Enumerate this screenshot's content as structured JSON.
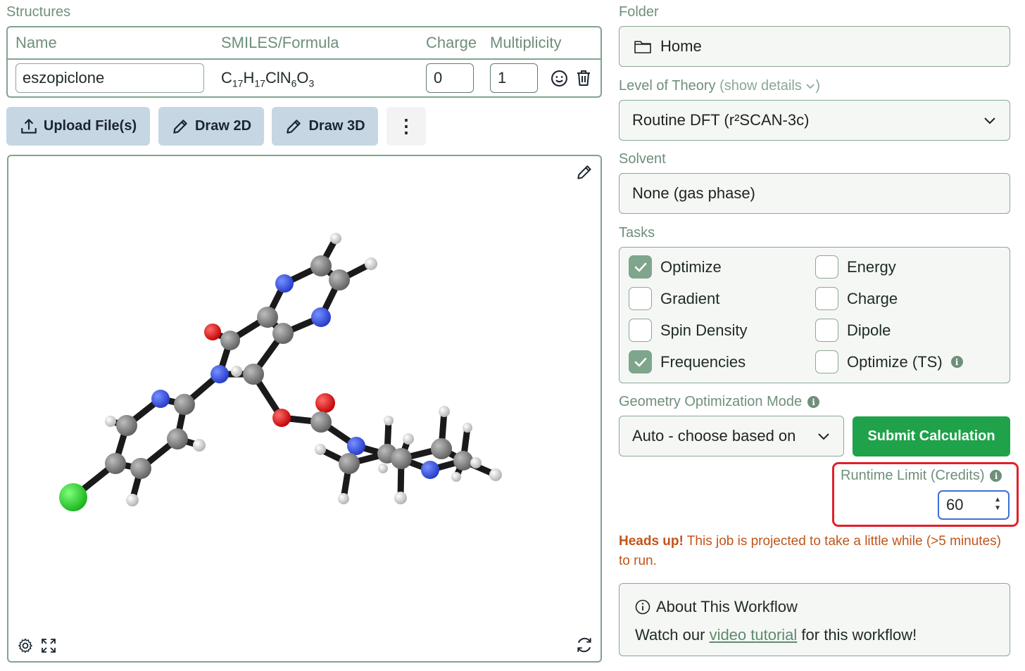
{
  "structures": {
    "label": "Structures",
    "headers": {
      "name": "Name",
      "smiles": "SMILES/Formula",
      "charge": "Charge",
      "multiplicity": "Multiplicity"
    },
    "row": {
      "name": "eszopiclone",
      "formula": {
        "c": "C",
        "c_n": "17",
        "h": "H",
        "h_n": "17",
        "clnn": "ClN",
        "n_n": "6",
        "o": "O",
        "o_n": "3"
      },
      "charge": "0",
      "multiplicity": "1"
    },
    "buttons": {
      "upload": "Upload File(s)",
      "draw2d": "Draw 2D",
      "draw3d": "Draw 3D",
      "more": "⋮"
    }
  },
  "folder": {
    "label": "Folder",
    "value": "Home"
  },
  "level_of_theory": {
    "label": "Level of Theory",
    "details_link": "(show details",
    "value": "Routine DFT (r²SCAN-3c)"
  },
  "solvent": {
    "label": "Solvent",
    "value": "None (gas phase)"
  },
  "tasks": {
    "label": "Tasks",
    "items": [
      {
        "label": "Optimize",
        "checked": true
      },
      {
        "label": "Energy",
        "checked": false
      },
      {
        "label": "Gradient",
        "checked": false
      },
      {
        "label": "Charge",
        "checked": false
      },
      {
        "label": "Spin Density",
        "checked": false
      },
      {
        "label": "Dipole",
        "checked": false
      },
      {
        "label": "Frequencies",
        "checked": true
      },
      {
        "label": "Optimize (TS)",
        "checked": false
      }
    ]
  },
  "geometry_mode": {
    "label": "Geometry Optimization Mode",
    "value": "Auto - choose based on"
  },
  "submit": {
    "label": "Submit Calculation"
  },
  "runtime": {
    "label": "Runtime Limit (Credits)",
    "value": "60"
  },
  "warning": {
    "bold": "Heads up!",
    "text": " This job is projected to take a little while (>5 minutes) to run."
  },
  "about": {
    "title": "About This Workflow",
    "text_before": "Watch our ",
    "link": "video tutorial",
    "text_after": " for this workflow!"
  },
  "colors": {
    "accent": "#7fa58c",
    "submit": "#1fa24a",
    "highlight": "#e0202a",
    "warning": "#c2541a",
    "button_bg": "#c6d6e3"
  }
}
